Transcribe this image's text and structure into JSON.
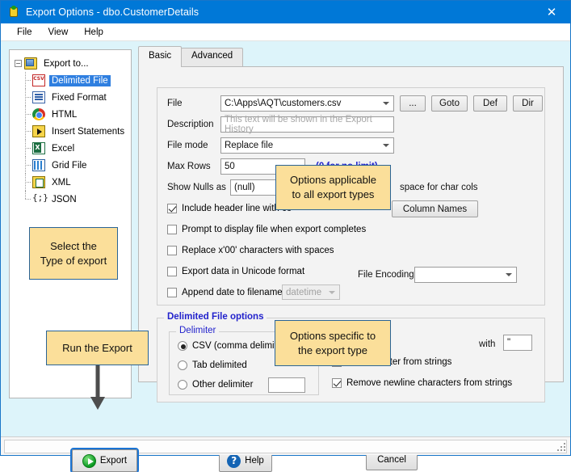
{
  "window": {
    "title": "Export Options - dbo.CustomerDetails",
    "close_label": "✕",
    "app_icon": "export-app-icon"
  },
  "menu": {
    "items": [
      "File",
      "View",
      "Help"
    ]
  },
  "tree": {
    "root_label": "Export to...",
    "expander": "−",
    "items": [
      {
        "label": "Delimited File",
        "icon": "csv-icon",
        "selected": true
      },
      {
        "label": "Fixed Format",
        "icon": "fixed-format-icon",
        "selected": false
      },
      {
        "label": "HTML",
        "icon": "html-icon",
        "selected": false
      },
      {
        "label": "Insert Statements",
        "icon": "insert-statements-icon",
        "selected": false
      },
      {
        "label": "Excel",
        "icon": "excel-icon",
        "selected": false
      },
      {
        "label": "Grid File",
        "icon": "grid-file-icon",
        "selected": false
      },
      {
        "label": "XML",
        "icon": "xml-icon",
        "selected": false
      },
      {
        "label": "JSON",
        "icon": "json-icon",
        "selected": false
      }
    ]
  },
  "callouts": {
    "select_type": "Select the\nType of export",
    "run_export": "Run the Export",
    "options_all": "Options applicable\nto all export types",
    "options_specific": "Options specific to\nthe export type"
  },
  "tabs": [
    {
      "label": "Basic",
      "active": true
    },
    {
      "label": "Advanced",
      "active": false
    }
  ],
  "form": {
    "file_label": "File",
    "file_value": "C:\\Apps\\AQT\\customers.csv",
    "browse_label": "...",
    "goto_label": "Goto",
    "def_label": "Def",
    "dir_label": "Dir",
    "description_label": "Description",
    "description_value": "",
    "description_placeholder": "This text will be shown in the Export History",
    "file_mode_label": "File mode",
    "file_mode_value": "Replace file",
    "max_rows_label": "Max Rows",
    "max_rows_value": "50",
    "max_rows_hint": "(0 for no limit)",
    "show_nulls_label": "Show Nulls as",
    "show_nulls_value": "(null)",
    "trailing_space_label": "space for char cols",
    "column_names_button": "Column Names",
    "file_encoding_label": "File Encoding",
    "file_encoding_value": "",
    "append_date_value": "datetime"
  },
  "checkboxes": [
    {
      "label": "Include header line with co",
      "checked": true
    },
    {
      "label": "Prompt to display file when export completes",
      "checked": false
    },
    {
      "label": "Replace x'00' characters with spaces",
      "checked": false
    },
    {
      "label": "Export data in Unicode format",
      "checked": false
    },
    {
      "label": "Append date to filename",
      "checked": false
    }
  ],
  "delimited": {
    "group_title": "Delimited File options",
    "delimiter_title": "Delimiter",
    "radios": [
      {
        "label": "CSV (comma delimited)",
        "selected": true
      },
      {
        "label": "Tab delimited",
        "selected": false
      },
      {
        "label": "Other delimiter",
        "selected": false
      }
    ],
    "other_delimiter_value": "",
    "with_label": "with",
    "quote_char_value": "\"",
    "strip_delim_label": "iter character from strings",
    "remove_newline_label": "Remove newline characters from strings",
    "remove_newline_checked": true
  },
  "footer": {
    "export_label": "Export",
    "help_label": "Help",
    "cancel_label": "Cancel"
  },
  "colors": {
    "titlebar": "#0078d7",
    "accent_blue": "#2222cc",
    "callout_bg": "#fbdf9a",
    "callout_border": "#2a6496",
    "selection": "#2f7fe0",
    "window_bg": "#ddf4fa"
  }
}
